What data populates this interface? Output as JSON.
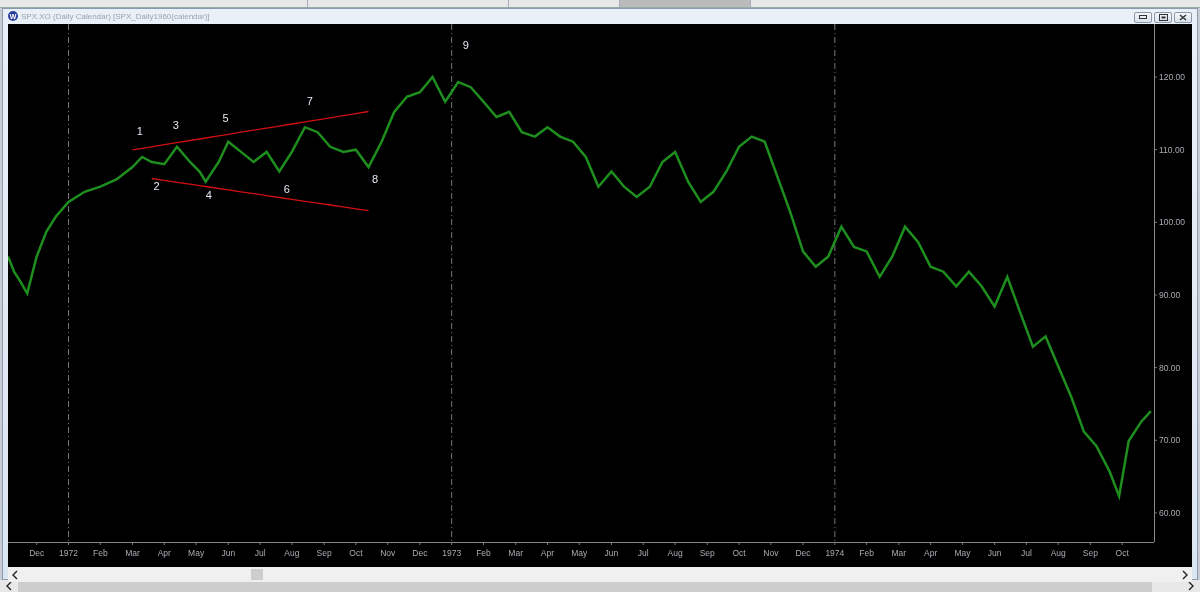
{
  "window": {
    "icon_letter": "W",
    "title": "SPX.XO (Daily Calendar) [SPX_Daily1960(calendar)]"
  },
  "chart": {
    "chart_data": {
      "type": "line",
      "x": [
        1971.842,
        1971.858,
        1971.875,
        1971.892,
        1971.917,
        1971.942,
        1971.967,
        1972.0,
        1972.042,
        1972.083,
        1972.125,
        1972.167,
        1972.192,
        1972.217,
        1972.25,
        1972.283,
        1972.317,
        1972.342,
        1972.358,
        1972.392,
        1972.417,
        1972.45,
        1972.483,
        1972.517,
        1972.55,
        1972.583,
        1972.617,
        1972.65,
        1972.683,
        1972.717,
        1972.75,
        1972.783,
        1972.817,
        1972.85,
        1972.883,
        1972.917,
        1972.95,
        1972.983,
        1973.017,
        1973.05,
        1973.083,
        1973.117,
        1973.15,
        1973.183,
        1973.217,
        1973.25,
        1973.283,
        1973.317,
        1973.35,
        1973.383,
        1973.417,
        1973.45,
        1973.483,
        1973.517,
        1973.55,
        1973.583,
        1973.617,
        1973.65,
        1973.683,
        1973.717,
        1973.75,
        1973.783,
        1973.817,
        1973.85,
        1973.883,
        1973.917,
        1973.95,
        1973.983,
        1974.017,
        1974.05,
        1974.083,
        1974.117,
        1974.15,
        1974.183,
        1974.217,
        1974.25,
        1974.283,
        1974.317,
        1974.35,
        1974.383,
        1974.417,
        1974.45,
        1974.483,
        1974.517,
        1974.55,
        1974.583,
        1974.617,
        1974.65,
        1974.683,
        1974.717,
        1974.742,
        1974.767,
        1974.8,
        1974.825
      ],
      "series": [
        {
          "color": "#1e8f1e",
          "values": [
            95.3,
            93.2,
            91.8,
            90.2,
            95.3,
            98.7,
            100.8,
            102.8,
            104.2,
            104.9,
            105.9,
            107.6,
            109,
            108.3,
            108,
            110.4,
            108.3,
            107,
            105.6,
            108.3,
            111.1,
            109.7,
            108.3,
            109.7,
            107,
            109.7,
            113.1,
            112.4,
            110.4,
            109.7,
            110,
            107.6,
            111.1,
            115.2,
            117.3,
            117.9,
            120,
            116.6,
            119.3,
            118.6,
            116.6,
            114.5,
            115.2,
            112.4,
            111.8,
            113.1,
            111.8,
            111.1,
            109,
            104.9,
            107,
            104.9,
            103.5,
            104.9,
            108.3,
            109.7,
            105.6,
            102.8,
            104.2,
            107,
            110.4,
            111.8,
            111.1,
            106.3,
            101.5,
            96,
            93.9,
            95.3,
            99.4,
            96.6,
            96,
            92.5,
            95.3,
            99.4,
            97.3,
            93.9,
            93.2,
            91.2,
            93.2,
            91.2,
            88.4,
            92.5,
            87.7,
            82.9,
            84.3,
            80.2,
            76,
            71.2,
            69.2,
            65.7,
            62.3,
            69.9,
            72.6,
            74
          ]
        },
        {
          "color": "#d01010",
          "values": [
            null,
            null,
            null,
            null,
            null,
            null,
            null,
            null,
            null,
            null,
            null,
            109.97,
            110.18,
            110.4,
            110.68,
            110.96,
            111.26,
            111.47,
            111.61,
            111.9,
            112.11,
            112.4,
            112.68,
            112.97,
            113.25,
            113.54,
            113.83,
            114.11,
            114.39,
            114.68,
            114.97,
            115.25,
            null,
            null,
            null,
            null,
            null,
            null,
            null,
            null,
            null,
            null,
            null,
            null,
            null,
            null,
            null,
            null,
            null,
            null,
            null,
            null,
            null,
            null,
            null,
            null,
            null,
            null,
            null,
            null,
            null,
            null,
            null,
            null,
            null,
            null,
            null,
            null,
            null,
            null,
            null,
            null,
            null,
            null,
            null,
            null,
            null,
            null,
            null,
            null,
            null,
            null,
            null,
            null,
            null,
            null,
            null,
            null,
            null,
            null,
            null,
            null,
            null,
            null
          ]
        },
        {
          "color": "#d01010",
          "values": [
            null,
            null,
            null,
            null,
            null,
            null,
            null,
            null,
            null,
            null,
            null,
            null,
            null,
            106.03,
            105.77,
            105.51,
            105.25,
            105.05,
            104.93,
            104.66,
            104.46,
            104.21,
            103.95,
            103.68,
            103.42,
            103.16,
            102.9,
            102.64,
            102.38,
            102.12,
            101.86,
            101.6,
            null,
            null,
            null,
            null,
            null,
            null,
            null,
            null,
            null,
            null,
            null,
            null,
            null,
            null,
            null,
            null,
            null,
            null,
            null,
            null,
            null,
            null,
            null,
            null,
            null,
            null,
            null,
            null,
            null,
            null,
            null,
            null,
            null,
            null,
            null,
            null,
            null,
            null,
            null,
            null,
            null,
            null,
            null,
            null,
            null,
            null,
            null,
            null,
            null,
            null,
            null,
            null,
            null,
            null,
            null,
            null,
            null,
            null,
            null,
            null,
            null,
            null
          ]
        }
      ],
      "grid": true,
      "xlim": [
        1971.842,
        1974.833
      ],
      "ylim": [
        56,
        127.3
      ],
      "xticks": [
        {
          "value": 1971.917,
          "label": "Dec"
        },
        {
          "value": 1972,
          "label": "1972"
        },
        {
          "value": 1972.083,
          "label": "Feb"
        },
        {
          "value": 1972.167,
          "label": "Mar"
        },
        {
          "value": 1972.25,
          "label": "Apr"
        },
        {
          "value": 1972.333,
          "label": "May"
        },
        {
          "value": 1972.417,
          "label": "Jun"
        },
        {
          "value": 1972.5,
          "label": "Jul"
        },
        {
          "value": 1972.583,
          "label": "Aug"
        },
        {
          "value": 1972.667,
          "label": "Sep"
        },
        {
          "value": 1972.75,
          "label": "Oct"
        },
        {
          "value": 1972.833,
          "label": "Nov"
        },
        {
          "value": 1972.917,
          "label": "Dec"
        },
        {
          "value": 1973,
          "label": "1973"
        },
        {
          "value": 1973.083,
          "label": "Feb"
        },
        {
          "value": 1973.167,
          "label": "Mar"
        },
        {
          "value": 1973.25,
          "label": "Apr"
        },
        {
          "value": 1973.333,
          "label": "May"
        },
        {
          "value": 1973.417,
          "label": "Jun"
        },
        {
          "value": 1973.5,
          "label": "Jul"
        },
        {
          "value": 1973.583,
          "label": "Aug"
        },
        {
          "value": 1973.667,
          "label": "Sep"
        },
        {
          "value": 1973.75,
          "label": "Oct"
        },
        {
          "value": 1973.833,
          "label": "Nov"
        },
        {
          "value": 1973.917,
          "label": "Dec"
        },
        {
          "value": 1974,
          "label": "1974"
        },
        {
          "value": 1974.083,
          "label": "Feb"
        },
        {
          "value": 1974.167,
          "label": "Mar"
        },
        {
          "value": 1974.25,
          "label": "Apr"
        },
        {
          "value": 1974.333,
          "label": "May"
        },
        {
          "value": 1974.417,
          "label": "Jun"
        },
        {
          "value": 1974.5,
          "label": "Jul"
        },
        {
          "value": 1974.583,
          "label": "Aug"
        },
        {
          "value": 1974.667,
          "label": "Sep"
        },
        {
          "value": 1974.75,
          "label": "Oct"
        }
      ],
      "yticks": [
        {
          "value": 60,
          "label": "60.00"
        },
        {
          "value": 70,
          "label": "70.00"
        },
        {
          "value": 80,
          "label": "80.00"
        },
        {
          "value": 90,
          "label": "90.00"
        },
        {
          "value": 100,
          "label": "100.00"
        },
        {
          "value": 110,
          "label": "110.00"
        },
        {
          "value": 120,
          "label": "120.00"
        }
      ],
      "annotations": [
        "1",
        "2",
        "3",
        "4",
        "5",
        "6",
        "7",
        "8",
        "9"
      ]
    }
  }
}
